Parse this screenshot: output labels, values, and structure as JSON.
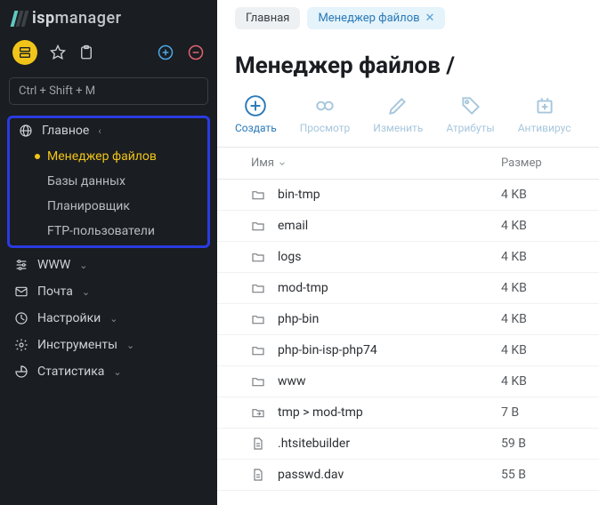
{
  "logo": {
    "name": "isp",
    "suffix": "manager"
  },
  "search": {
    "placeholder": "Ctrl + Shift + M"
  },
  "nav": {
    "main_group": {
      "label": "Главное",
      "items": [
        {
          "label": "Менеджер файлов",
          "active": true
        },
        {
          "label": "Базы данных",
          "active": false
        },
        {
          "label": "Планировщик",
          "active": false
        },
        {
          "label": "FTP-пользователи",
          "active": false
        }
      ]
    },
    "groups": [
      {
        "label": "WWW"
      },
      {
        "label": "Почта"
      },
      {
        "label": "Настройки"
      },
      {
        "label": "Инструменты"
      },
      {
        "label": "Статистика"
      }
    ]
  },
  "tabs": [
    {
      "label": "Главная",
      "active": false,
      "closable": false
    },
    {
      "label": "Менеджер файлов",
      "active": true,
      "closable": true
    }
  ],
  "page_title": "Менеджер файлов /",
  "toolbar": [
    {
      "key": "create",
      "label": "Создать"
    },
    {
      "key": "view",
      "label": "Просмотр"
    },
    {
      "key": "edit",
      "label": "Изменить"
    },
    {
      "key": "attrs",
      "label": "Атрибуты"
    },
    {
      "key": "antivirus",
      "label": "Антивирус"
    }
  ],
  "columns": {
    "name": "Имя",
    "size": "Размер"
  },
  "files": [
    {
      "type": "folder",
      "name": "bin-tmp",
      "size": "4 KB"
    },
    {
      "type": "folder",
      "name": "email",
      "size": "4 KB"
    },
    {
      "type": "folder",
      "name": "logs",
      "size": "4 KB"
    },
    {
      "type": "folder",
      "name": "mod-tmp",
      "size": "4 KB"
    },
    {
      "type": "folder",
      "name": "php-bin",
      "size": "4 KB"
    },
    {
      "type": "folder",
      "name": "php-bin-isp-php74",
      "size": "4 KB"
    },
    {
      "type": "folder",
      "name": "www",
      "size": "4 KB"
    },
    {
      "type": "link",
      "name": "tmp > mod-tmp",
      "size": "7 B"
    },
    {
      "type": "file",
      "name": ".htsitebuilder",
      "size": "59 B"
    },
    {
      "type": "file",
      "name": "passwd.dav",
      "size": "55 B"
    }
  ],
  "nav_icons": {
    "www": "sliders",
    "mail": "mail",
    "settings": "dashboard",
    "tools": "gear",
    "stats": "pie"
  }
}
